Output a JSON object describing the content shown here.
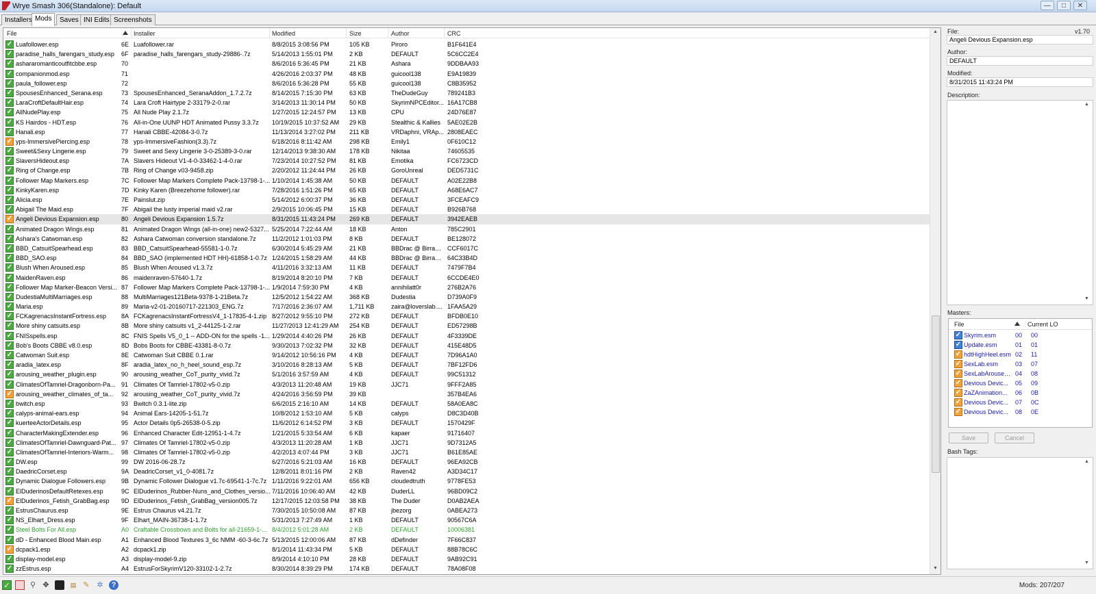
{
  "window": {
    "title": "Wrye Smash 306(Standalone): Default",
    "controls": [
      "—",
      "□",
      "✕"
    ]
  },
  "tabs": [
    {
      "label": "Installers",
      "active": false
    },
    {
      "label": "Mods",
      "active": true
    },
    {
      "label": "Saves",
      "active": false
    },
    {
      "label": "INI Edits",
      "active": false
    },
    {
      "label": "Screenshots",
      "active": false
    }
  ],
  "columns": {
    "file": "File",
    "installer": "Installer",
    "modified": "Modified",
    "size": "Size",
    "author": "Author",
    "crc": "CRC"
  },
  "mods": [
    {
      "file": "Luafollower.esp",
      "idx": "6E",
      "installer": "Luafollower.rar",
      "modified": "8/8/2015 3:08:56 PM",
      "size": "105 KB",
      "author": "Piroro",
      "crc": "B1F641E4",
      "check": "green"
    },
    {
      "file": "paradise_halls_farengars_study.esp",
      "idx": "6F",
      "installer": "paradise_halls_farengars_study-29886-.7z",
      "modified": "5/14/2013 1:55:01 PM",
      "size": "2 KB",
      "author": "DEFAULT",
      "crc": "5C6CC2E4",
      "check": "green"
    },
    {
      "file": "ashararomanticoutfitcbbe.esp",
      "idx": "70",
      "installer": "",
      "modified": "8/6/2016 5:36:45 PM",
      "size": "21 KB",
      "author": "Ashara",
      "crc": "9DDBAA93",
      "check": "green"
    },
    {
      "file": "companionmod.esp",
      "idx": "71",
      "installer": "",
      "modified": "4/26/2016 2:03:37 PM",
      "size": "48 KB",
      "author": "guicool138",
      "crc": "E9A19839",
      "check": "green"
    },
    {
      "file": "paula_follower.esp",
      "idx": "72",
      "installer": "",
      "modified": "8/6/2016 5:36:28 PM",
      "size": "55 KB",
      "author": "guicool138",
      "crc": "C8B35952",
      "check": "green"
    },
    {
      "file": "SpousesEnhanced_Serana.esp",
      "idx": "73",
      "installer": "SpousesEnhanced_SeranaAddon_1.7.2.7z",
      "modified": "8/14/2015 7:15:30 PM",
      "size": "63 KB",
      "author": "TheDudeGuy",
      "crc": "789241B3",
      "check": "green"
    },
    {
      "file": "LaraCroftDefaultHair.esp",
      "idx": "74",
      "installer": "Lara Croft Hairtype 2-33179-2-0.rar",
      "modified": "3/14/2013 11:30:14 PM",
      "size": "50 KB",
      "author": "SkyrimNPCEditor...",
      "crc": "16A17CB8",
      "check": "green"
    },
    {
      "file": "AllNudePlay.esp",
      "idx": "75",
      "installer": "All Nude Play 2.1.7z",
      "modified": "1/27/2015 12:24:57 PM",
      "size": "13 KB",
      "author": "CPU",
      "crc": "24D76E87",
      "check": "green"
    },
    {
      "file": "KS Hairdos - HDT.esp",
      "idx": "76",
      "installer": "All-in-One UUNP HDT Animated Pussy 3.3.7z",
      "modified": "10/19/2015 10:37:52 AM",
      "size": "29 KB",
      "author": "Stealthic & Kallies",
      "crc": "5AE02E2B",
      "check": "green"
    },
    {
      "file": "Hanali.esp",
      "idx": "77",
      "installer": "Hanali CBBE-42084-3-0.7z",
      "modified": "11/13/2014 3:27:02 PM",
      "size": "211 KB",
      "author": "VRDaphni, VRAp...",
      "crc": "2808EAEC",
      "check": "green"
    },
    {
      "file": "yps-ImmersivePiercing.esp",
      "idx": "78",
      "installer": "yps-ImmersiveFashion(3.3).7z",
      "modified": "6/18/2016 8:11:42 AM",
      "size": "298 KB",
      "author": "Emily1",
      "crc": "0F610C12",
      "check": "orange"
    },
    {
      "file": "Sweet&Sexy Lingerie.esp",
      "idx": "79",
      "installer": "Sweet and Sexy Lingerie 3-0-25389-3-0.rar",
      "modified": "12/14/2013 9:38:30 AM",
      "size": "178 KB",
      "author": "Nikitaa",
      "crc": "74605535",
      "check": "green"
    },
    {
      "file": "SlaversHideout.esp",
      "idx": "7A",
      "installer": "Slavers Hideout V1-4-0-33462-1-4-0.rar",
      "modified": "7/23/2014 10:27:52 PM",
      "size": "81 KB",
      "author": "Emotika",
      "crc": "FC6723CD",
      "check": "green"
    },
    {
      "file": "Ring of Change.esp",
      "idx": "7B",
      "installer": "Ring of Change v03-9458.zip",
      "modified": "2/20/2012 11:24:44 PM",
      "size": "26 KB",
      "author": "GoroUnreal",
      "crc": "DED5731C",
      "check": "green"
    },
    {
      "file": "Follower Map Markers.esp",
      "idx": "7C",
      "installer": "Follower Map Markers Complete Pack-13798-1-...",
      "modified": "1/10/2014 1:45:38 AM",
      "size": "50 KB",
      "author": "DEFAULT",
      "crc": "A02E22B8",
      "check": "green"
    },
    {
      "file": "KinkyKaren.esp",
      "idx": "7D",
      "installer": "Kinky Karen (Breezehome follower).rar",
      "modified": "7/28/2016 1:51:26 PM",
      "size": "65 KB",
      "author": "DEFAULT",
      "crc": "A68E6AC7",
      "check": "green"
    },
    {
      "file": "Alicia.esp",
      "idx": "7E",
      "installer": "Painslut.zip",
      "modified": "5/14/2012 6:00:37 PM",
      "size": "36 KB",
      "author": "DEFAULT",
      "crc": "3FCEAFC9",
      "check": "green"
    },
    {
      "file": "Abigail The Maid.esp",
      "idx": "7F",
      "installer": "Abigail the lusty imperial maid v2.rar",
      "modified": "2/9/2015 10:06:45 PM",
      "size": "15 KB",
      "author": "DEFAULT",
      "crc": "B926B768",
      "check": "green"
    },
    {
      "file": "Angeli Devious Expansion.esp",
      "idx": "80",
      "installer": "Angeli Devious Expansion 1.5.7z",
      "modified": "8/31/2015 11:43:24 PM",
      "size": "269 KB",
      "author": "DEFAULT",
      "crc": "3942EAEB",
      "check": "orange",
      "selected": true
    },
    {
      "file": "Animated Dragon Wings.esp",
      "idx": "81",
      "installer": "Animated Dragon Wings (all-in-one) new2-5327...",
      "modified": "5/25/2014 7:22:44 AM",
      "size": "18 KB",
      "author": "Anton",
      "crc": "785C2901",
      "check": "green"
    },
    {
      "file": "Ashara's Catwoman.esp",
      "idx": "82",
      "installer": "Ashara Catwoman conversion standalone.7z",
      "modified": "11/2/2012 1:01:03 PM",
      "size": "8 KB",
      "author": "DEFAULT",
      "crc": "BE128072",
      "check": "green"
    },
    {
      "file": "BBD_CatsuitSpearhead.esp",
      "idx": "83",
      "installer": "BBD_CatsuitSpearhead-55581-1-0.7z",
      "modified": "6/30/2014 5:45:29 AM",
      "size": "21 KB",
      "author": "BBDrac @ BirraBr...",
      "crc": "CCF6017C",
      "check": "green"
    },
    {
      "file": "BBD_SAO.esp",
      "idx": "84",
      "installer": "BBD_SAO (implemented HDT HH)-61858-1-0.7z",
      "modified": "1/24/2015 1:58:29 AM",
      "size": "44 KB",
      "author": "BBDrac @ BirraBr...",
      "crc": "64C33B4D",
      "check": "green"
    },
    {
      "file": "Blush When Aroused.esp",
      "idx": "85",
      "installer": "Blush When Aroused v1.3.7z",
      "modified": "4/11/2016 3:32:13 AM",
      "size": "11 KB",
      "author": "DEFAULT",
      "crc": "7479F7B4",
      "check": "green"
    },
    {
      "file": "MaidenRaven.esp",
      "idx": "86",
      "installer": "maidenraven-57640-1.7z",
      "modified": "8/19/2014 8:20:10 PM",
      "size": "7 KB",
      "author": "DEFAULT",
      "crc": "6CCDE4E0",
      "check": "green"
    },
    {
      "file": "Follower Map Marker-Beacon Versi...",
      "idx": "87",
      "installer": "Follower Map Markers Complete Pack-13798-1-...",
      "modified": "1/9/2014 7:59:30 PM",
      "size": "4 KB",
      "author": "annihilatt0r",
      "crc": "276B2A76",
      "check": "green"
    },
    {
      "file": "DudestiaMultiMarriages.esp",
      "idx": "88",
      "installer": "MultiMarriages121Beta-9378-1-21Beta.7z",
      "modified": "12/5/2012 1:54:22 AM",
      "size": "368 KB",
      "author": "Dudestia",
      "crc": "D739A0F9",
      "check": "green"
    },
    {
      "file": "Maria.esp",
      "idx": "89",
      "installer": "Maria-v2-01-20160717-221303_ENG.7z",
      "modified": "7/17/2016 2:36:07 AM",
      "size": "1,711 KB",
      "author": "zaira@loverslab....",
      "crc": "1FAA5A29",
      "check": "green"
    },
    {
      "file": "FCKagrenacsInstantFortress.esp",
      "idx": "8A",
      "installer": "FCKagrenacsInstantFortressV4_1-17835-4-1.zip",
      "modified": "8/27/2012 9:55:10 PM",
      "size": "272 KB",
      "author": "DEFAULT",
      "crc": "BFDB0E10",
      "check": "green"
    },
    {
      "file": "More shiny catsuits.esp",
      "idx": "8B",
      "installer": "More shiny catsuits v1_2-44125-1-2.rar",
      "modified": "11/27/2013 12:41:29 AM",
      "size": "254 KB",
      "author": "DEFAULT",
      "crc": "ED57298B",
      "check": "green"
    },
    {
      "file": "FNISspells.esp",
      "idx": "8C",
      "installer": "FNIS Spells V5_0_1 -- ADD-ON for the spells -11...",
      "modified": "1/29/2014 4:40:26 PM",
      "size": "26 KB",
      "author": "DEFAULT",
      "crc": "4F3339DE",
      "check": "green"
    },
    {
      "file": "Bob's Boots CBBE v8.0.esp",
      "idx": "8D",
      "installer": "Bobs Boots for CBBE-43381-8-0.7z",
      "modified": "9/30/2013 7:02:32 PM",
      "size": "32 KB",
      "author": "DEFAULT",
      "crc": "415E48D5",
      "check": "green"
    },
    {
      "file": "Catwoman Suit.esp",
      "idx": "8E",
      "installer": "Catwoman Suit CBBE 0.1.rar",
      "modified": "9/14/2012 10:56:16 PM",
      "size": "4 KB",
      "author": "DEFAULT",
      "crc": "7D96A1A0",
      "check": "green"
    },
    {
      "file": "aradia_latex.esp",
      "idx": "8F",
      "installer": "aradia_latex_no_h_heel_sound_esp.7z",
      "modified": "3/10/2016 8:28:13 AM",
      "size": "5 KB",
      "author": "DEFAULT",
      "crc": "7BF12FD6",
      "check": "green"
    },
    {
      "file": "arousing_weather_plugin.esp",
      "idx": "90",
      "installer": "arousing_weather_CoT_purity_vivid.7z",
      "modified": "5/1/2016 3:57:59 AM",
      "size": "4 KB",
      "author": "DEFAULT",
      "crc": "99C51312",
      "check": "green"
    },
    {
      "file": "ClimatesOfTamriel-Dragonborn-Pa...",
      "idx": "91",
      "installer": "Climates Of Tamriel-17802-v5-0.zip",
      "modified": "4/3/2013 11:20:48 AM",
      "size": "19 KB",
      "author": "JJC71",
      "crc": "9FFF2A85",
      "check": "green"
    },
    {
      "file": "arousing_weather_climates_of_ta...",
      "idx": "92",
      "installer": "arousing_weather_CoT_purity_vivid.7z",
      "modified": "4/24/2016 3:56:59 PM",
      "size": "39 KB",
      "author": "",
      "crc": "357B4EA6",
      "check": "orange"
    },
    {
      "file": "bwitch.esp",
      "idx": "93",
      "installer": "Bwitch 0.3.1-lite.zip",
      "modified": "6/6/2015 2:16:10 AM",
      "size": "14 KB",
      "author": "DEFAULT",
      "crc": "58A0EA8C",
      "check": "green"
    },
    {
      "file": "calyps-animal-ears.esp",
      "idx": "94",
      "installer": "Animal Ears-14205-1-51.7z",
      "modified": "10/8/2012 1:53:10 AM",
      "size": "5 KB",
      "author": "calyps",
      "crc": "D8C3D40B",
      "check": "green"
    },
    {
      "file": "kuerteeActorDetails.esp",
      "idx": "95",
      "installer": "Actor Details 0p5-26538-0-5.zip",
      "modified": "11/6/2012 6:14:52 PM",
      "size": "3 KB",
      "author": "DEFAULT",
      "crc": "1570429F",
      "check": "green"
    },
    {
      "file": "CharacterMakingExtender.esp",
      "idx": "96",
      "installer": "Enhanced Character Edit-12951-1-4.7z",
      "modified": "1/21/2015 5:33:54 AM",
      "size": "6 KB",
      "author": "kapaer",
      "crc": "91716407",
      "check": "green"
    },
    {
      "file": "ClimatesOfTamriel-Dawnguard-Pat...",
      "idx": "97",
      "installer": "Climates Of Tamriel-17802-v5-0.zip",
      "modified": "4/3/2013 11:20:28 AM",
      "size": "1 KB",
      "author": "JJC71",
      "crc": "9D7312A5",
      "check": "green"
    },
    {
      "file": "ClimatesOfTamriel-Interiors-Warm...",
      "idx": "98",
      "installer": "Climates Of Tamriel-17802-v5-0.zip",
      "modified": "4/2/2013 4:07:44 PM",
      "size": "3 KB",
      "author": "JJC71",
      "crc": "B61E85AE",
      "check": "green"
    },
    {
      "file": "DW.esp",
      "idx": "99",
      "installer": "DW 2016-06-28.7z",
      "modified": "6/27/2016 5:21:03 AM",
      "size": "16 KB",
      "author": "DEFAULT",
      "crc": "96EA92CB",
      "check": "green"
    },
    {
      "file": "DaedricCorset.esp",
      "idx": "9A",
      "installer": "DeadricCorset_v1_0-4081.7z",
      "modified": "12/8/2011 8:01:16 PM",
      "size": "2 KB",
      "author": "Raven42",
      "crc": "A3D34C17",
      "check": "green"
    },
    {
      "file": "Dynamic Dialogue Followers.esp",
      "idx": "9B",
      "installer": "Dynamic Follower Dialogue v1.7c-69541-1-7c.7z",
      "modified": "1/11/2016 9:22:01 AM",
      "size": "656 KB",
      "author": "cloudedtruth",
      "crc": "9778FE53",
      "check": "green"
    },
    {
      "file": "ElDuderinosDefaultRetexes.esp",
      "idx": "9C",
      "installer": "ElDuderinos_Rubber-Nuns_and_Clothes_versio...",
      "modified": "7/11/2016 10:06:40 AM",
      "size": "42 KB",
      "author": "DuderLL",
      "crc": "96BD09C2",
      "check": "green"
    },
    {
      "file": "ElDuderinos_Fetish_GrabBag.esp",
      "idx": "9D",
      "installer": "ElDuderinos_Fetish_GrabBag_version005.7z",
      "modified": "12/17/2015 12:03:58 PM",
      "size": "38 KB",
      "author": "The Duder",
      "crc": "D0AB2AEA",
      "check": "orange"
    },
    {
      "file": "EstrusChaurus.esp",
      "idx": "9E",
      "installer": "Estrus Chaurus v4.21.7z",
      "modified": "7/30/2015 10:50:08 AM",
      "size": "87 KB",
      "author": "jbezorg",
      "crc": "0ABEA273",
      "check": "green"
    },
    {
      "file": "NS_Elhart_Dress.esp",
      "idx": "9F",
      "installer": "Elhart_MAIN-36738-1-1.7z",
      "modified": "5/31/2013 7:27:49 AM",
      "size": "1 KB",
      "author": "DEFAULT",
      "crc": "90567C6A",
      "check": "green"
    },
    {
      "file": "Steel Bolts For All.esp",
      "idx": "A0",
      "installer": "Craftable Crossbows and Bolts for all-21659-1-...",
      "modified": "8/4/2012 5:01:28 AM",
      "size": "2 KB",
      "author": "DEFAULT",
      "crc": "10006381",
      "check": "green",
      "green": true
    },
    {
      "file": "dD - Enhanced Blood Main.esp",
      "idx": "A1",
      "installer": "Enhanced Blood Textures 3_6c NMM -60-3-6c.7z",
      "modified": "5/13/2015 12:00:06 AM",
      "size": "87 KB",
      "author": "dDefinder",
      "crc": "7F66C837",
      "check": "green"
    },
    {
      "file": "dcpack1.esp",
      "idx": "A2",
      "installer": "dcpack1.zip",
      "modified": "8/1/2014 11:43:34 PM",
      "size": "5 KB",
      "author": "DEFAULT",
      "crc": "88B78C6C",
      "check": "orange"
    },
    {
      "file": "display-model.esp",
      "idx": "A3",
      "installer": "display-model-9.zip",
      "modified": "8/9/2014 4:10:10 PM",
      "size": "28 KB",
      "author": "DEFAULT",
      "crc": "9AB92C91",
      "check": "green"
    },
    {
      "file": "zzEstrus.esp",
      "idx": "A4",
      "installer": "EstrusForSkyrimV120-33102-1-2.7z",
      "modified": "8/30/2014 8:39:29 PM",
      "size": "174 KB",
      "author": "DEFAULT",
      "crc": "78A08F08",
      "check": "green"
    }
  ],
  "details": {
    "file_label": "File:",
    "version": "v1.70",
    "file_value": "Angeli Devious Expansion.esp",
    "author_label": "Author:",
    "author_value": "DEFAULT",
    "modified_label": "Modified:",
    "modified_value": "8/31/2015 11:43:24 PM",
    "description_label": "Description:",
    "masters_label": "Masters:",
    "masters_col_file": "File",
    "masters_col_lo": "Current LO",
    "masters": [
      {
        "file": "Skyrim.esm",
        "a": "00",
        "b": "00",
        "check": "blue"
      },
      {
        "file": "Update.esm",
        "a": "01",
        "b": "01",
        "check": "blue"
      },
      {
        "file": "hdtHighHeel.esm",
        "a": "02",
        "b": "11",
        "check": "orange"
      },
      {
        "file": "SexLab.esm",
        "a": "03",
        "b": "07",
        "check": "orange"
      },
      {
        "file": "SexLabAroused...",
        "a": "04",
        "b": "08",
        "check": "orange"
      },
      {
        "file": "Devious Devic...",
        "a": "05",
        "b": "09",
        "check": "orange"
      },
      {
        "file": "ZaZAnimation...",
        "a": "06",
        "b": "0B",
        "check": "orange"
      },
      {
        "file": "Devious Devic...",
        "a": "07",
        "b": "0C",
        "check": "orange"
      },
      {
        "file": "Devious Devic...",
        "a": "08",
        "b": "0E",
        "check": "orange"
      }
    ],
    "save_label": "Save",
    "cancel_label": "Cancel",
    "bash_tags_label": "Bash Tags:"
  },
  "status": {
    "mods_count": "Mods: 207/207",
    "icons": [
      "checkbox-icon",
      "stop-icon",
      "pin-icon",
      "wrench-icon",
      "monitor-icon",
      "doc-icon",
      "edit-icon",
      "gear-icon",
      "help-icon"
    ]
  },
  "colors": {
    "check_green": "#4aab3e",
    "check_orange": "#f2a23a",
    "check_blue": "#3f83d8",
    "green_text": "#2e9b2e",
    "master_text": "#1a1aa8"
  }
}
